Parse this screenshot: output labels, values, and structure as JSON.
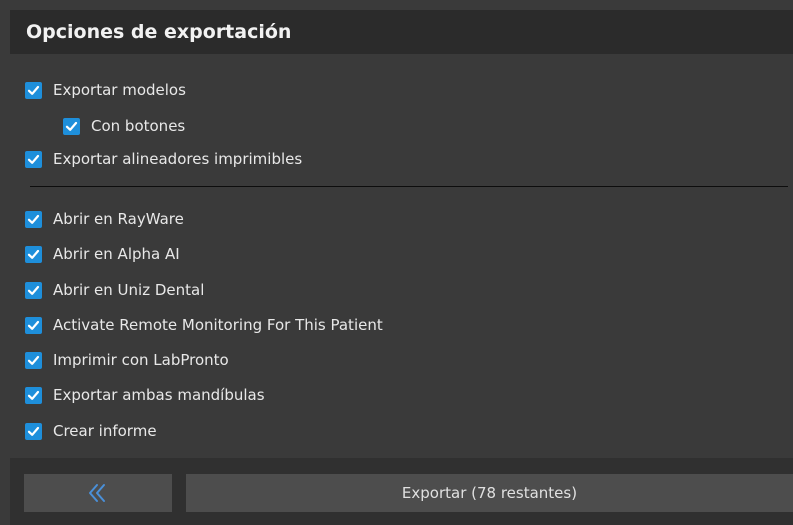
{
  "panel": {
    "title": "Opciones de exportación"
  },
  "options": [
    {
      "label": "Exportar modelos",
      "checked": true
    },
    {
      "label": "Con botones",
      "checked": true
    },
    {
      "label": "Exportar alineadores imprimibles",
      "checked": true
    },
    {
      "label": "Abrir en RayWare",
      "checked": true
    },
    {
      "label": "Abrir en Alpha AI",
      "checked": true
    },
    {
      "label": "Abrir en Uniz Dental",
      "checked": true
    },
    {
      "label": "Activate Remote Monitoring For This Patient",
      "checked": true
    },
    {
      "label": "Imprimir con LabPronto",
      "checked": true
    },
    {
      "label": "Exportar ambas mandíbulas",
      "checked": true
    },
    {
      "label": "Crear informe",
      "checked": true
    }
  ],
  "footer": {
    "back_icon": "double-chevron-left-icon",
    "export_label": "Exportar (78 restantes)"
  },
  "colors": {
    "checkbox": "#1e8fdb",
    "back_icon": "#4a90d9"
  }
}
